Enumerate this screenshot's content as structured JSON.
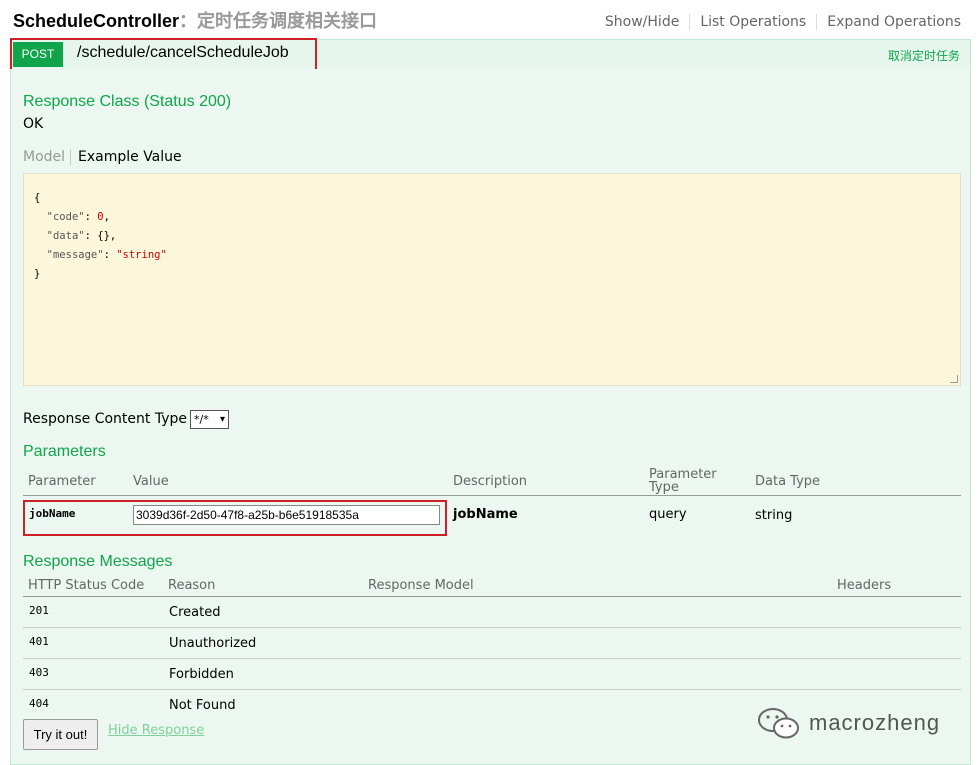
{
  "controller": {
    "name": "ScheduleController",
    "description": "：定时任务调度相关接口"
  },
  "header_ops": [
    "Show/Hide",
    "List Operations",
    "Expand Operations"
  ],
  "operation": {
    "method": "POST",
    "path": "/schedule/cancelScheduleJob",
    "summary": "取消定时任务"
  },
  "response_class": {
    "title": "Response Class (Status 200)",
    "value": "OK"
  },
  "tabs": {
    "model": "Model",
    "example": "Example Value"
  },
  "example_json": {
    "open": "{",
    "code_key": "\"code\"",
    "code_val": "0",
    "data_key": "\"data\"",
    "data_val": "{}",
    "message_key": "\"message\"",
    "message_val": "\"string\"",
    "close": "}"
  },
  "response_content_type": {
    "label": "Response Content Type",
    "selected": "*/*"
  },
  "parameters": {
    "title": "Parameters",
    "headers": [
      "Parameter",
      "Value",
      "Description",
      "Parameter Type",
      "Data Type"
    ],
    "rows": [
      {
        "name": "jobName",
        "value": "3039d36f-2d50-47f8-a25b-b6e51918535a",
        "description": "jobName",
        "param_type": "query",
        "data_type": "string"
      }
    ]
  },
  "response_messages": {
    "title": "Response Messages",
    "headers": [
      "HTTP Status Code",
      "Reason",
      "Response Model",
      "Headers"
    ],
    "rows": [
      {
        "code": "201",
        "reason": "Created"
      },
      {
        "code": "401",
        "reason": "Unauthorized"
      },
      {
        "code": "403",
        "reason": "Forbidden"
      },
      {
        "code": "404",
        "reason": "Not Found"
      }
    ]
  },
  "actions": {
    "try_it": "Try it out!",
    "hide_response": "Hide Response"
  },
  "watermark": {
    "text": "macrozheng",
    "icon": "wechat-icon"
  },
  "colors": {
    "accent_green": "#10a54a",
    "highlight_red": "#cc2128",
    "snippet_bg": "#fcf6db",
    "panel_bg": "#ebf7f0"
  }
}
